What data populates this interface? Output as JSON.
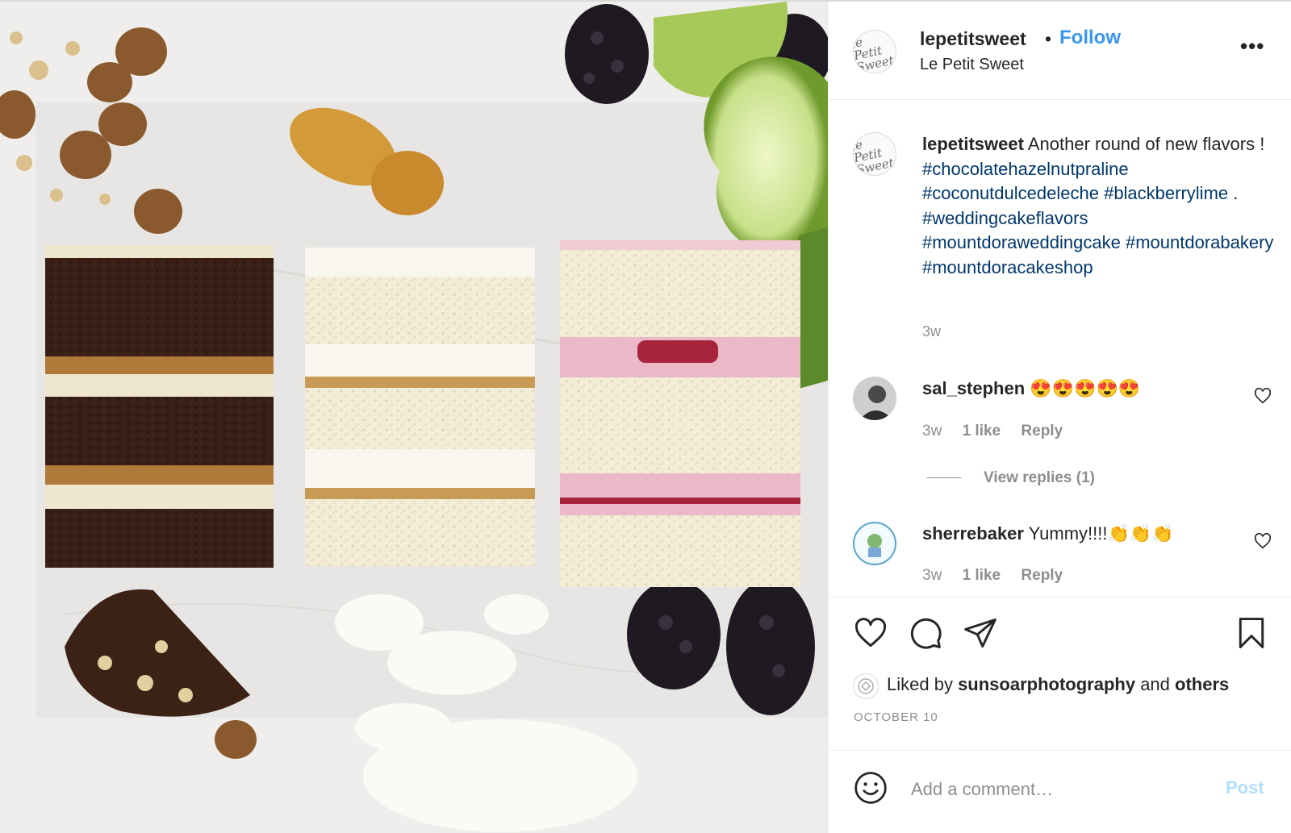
{
  "post": {
    "username": "lepetitsweet",
    "full_name": "Le Petit Sweet",
    "follow_label": "Follow",
    "separator": "•",
    "more_label": "•••",
    "avatar_monogram": "le Petit Sweet"
  },
  "caption": {
    "username": "lepetitsweet",
    "text_before": "Another round of new flavors ! ",
    "tags": [
      "#chocolatehazelnutpraline",
      "#coconutdulcedeleche",
      "#blackberrylime",
      "#weddingcakeflavors",
      "#mountdoraweddingcake",
      "#mountdorabakery",
      "#mountdoracakeshop"
    ],
    "between_3_4": " . ",
    "time": "3w"
  },
  "comments": [
    {
      "username": "sal_stephen",
      "text": "😍😍😍😍😍",
      "time": "3w",
      "likes": "1 like",
      "reply_label": "Reply",
      "view_replies": "View replies (1)"
    },
    {
      "username": "sherrebaker",
      "text": "Yummy!!!!👏👏👏",
      "time": "3w",
      "likes": "1 like",
      "reply_label": "Reply"
    }
  ],
  "actions": {
    "icons": [
      "heart-icon",
      "comment-icon",
      "share-icon",
      "bookmark-icon"
    ],
    "liked_by_prefix": "Liked by ",
    "liked_by_user": "sunsoarphotography",
    "liked_by_middle": " and ",
    "liked_by_others": "others",
    "date": "OCTOBER 10"
  },
  "add_comment": {
    "placeholder": "Add a comment…",
    "post_label": "Post"
  },
  "colors": {
    "link_blue": "#3897f0",
    "hashtag": "#00376b",
    "muted": "#8e8e8e",
    "post_disabled": "#b2dffc"
  }
}
